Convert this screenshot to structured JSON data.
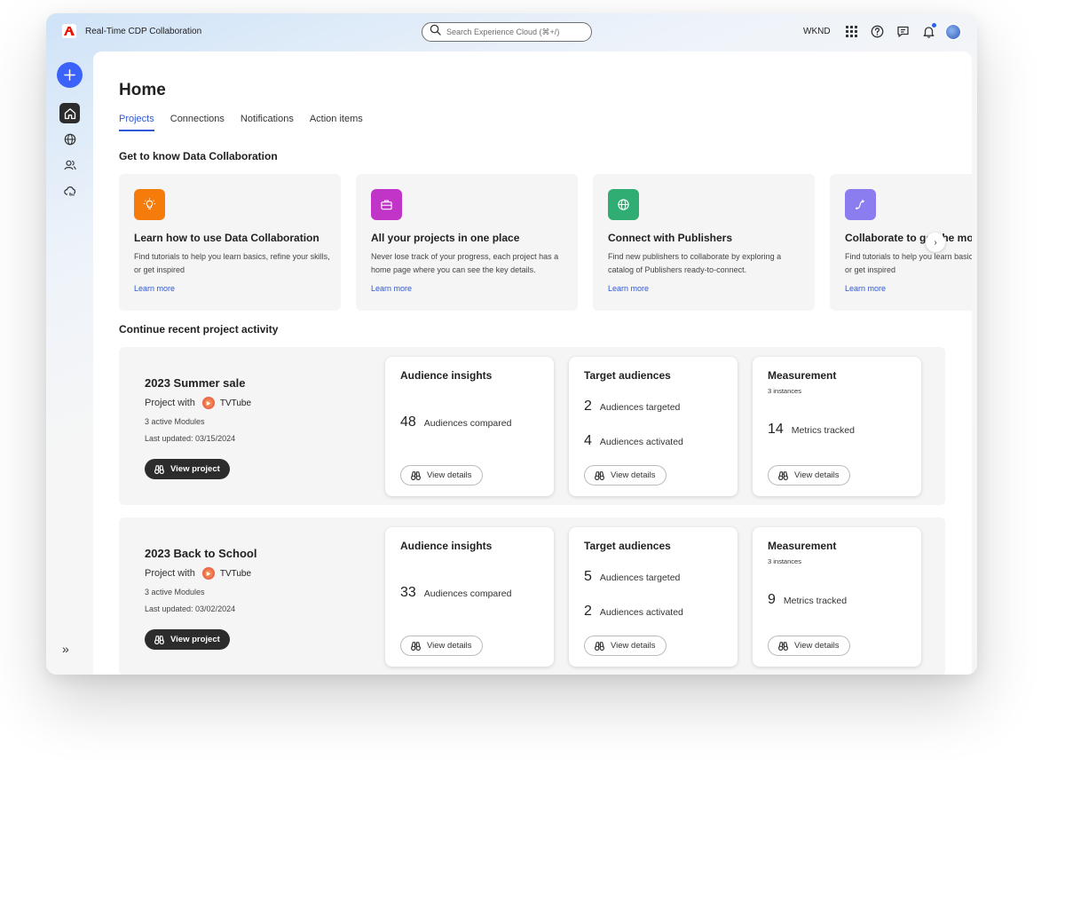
{
  "app": {
    "title": "Real-Time CDP Collaboration",
    "org": "WKND"
  },
  "search": {
    "placeholder": "Search Experience Cloud (⌘+/)"
  },
  "topbar_icons": [
    "apps-grid-icon",
    "help-icon",
    "feedback-icon",
    "bell-icon"
  ],
  "rail": {
    "items": [
      "home-icon",
      "globe-icon",
      "users-icon",
      "cloud-chart-icon"
    ],
    "expand_label": "»"
  },
  "page": {
    "title": "Home"
  },
  "tabs": [
    {
      "label": "Projects",
      "active": true
    },
    {
      "label": "Connections",
      "active": false
    },
    {
      "label": "Notifications",
      "active": false
    },
    {
      "label": "Action items",
      "active": false
    }
  ],
  "get_to_know": {
    "title": "Get to know Data Collaboration",
    "cards": [
      {
        "icon": "lightbulb-icon",
        "color": "#f57c0b",
        "title": "Learn how to use Data Collaboration",
        "description": "Find tutorials to help you learn basics, refine your skills, or get inspired",
        "link": "Learn more"
      },
      {
        "icon": "briefcase-icon",
        "color": "#c035c8",
        "title": "All your projects in one place",
        "description": "Never lose track of your progress, each project has a home page where you can see the key details.",
        "link": "Learn more"
      },
      {
        "icon": "globe-icon",
        "color": "#2fad72",
        "title": "Connect with Publishers",
        "description": "Find new publishers to collaborate by exploring a catalog of Publishers ready-to-connect.",
        "link": "Learn more"
      },
      {
        "icon": "path-icon",
        "color": "#8b7cf0",
        "title": "Collaborate to get the most",
        "description": "Find tutorials to help you learn basics, refine your skills, or get inspired",
        "link": "Learn more"
      }
    ],
    "next_label": "›"
  },
  "recent": {
    "title": "Continue recent project activity",
    "projects": [
      {
        "name": "2023 Summer sale",
        "with_label": "Project with",
        "partner": "TVTube",
        "modules_count": "3 active Modules",
        "last_updated": "Last updated: 03/15/2024",
        "view_label": "View project",
        "audience_insights": {
          "title": "Audience insights",
          "value": "48",
          "label": "Audiences compared",
          "button": "View details"
        },
        "target_audiences": {
          "title": "Target audiences",
          "targeted_value": "2",
          "targeted_label": "Audiences targeted",
          "activated_value": "4",
          "activated_label": "Audiences activated",
          "button": "View details"
        },
        "measurement": {
          "title": "Measurement",
          "instances": "3 instances",
          "value": "14",
          "label": "Metrics tracked",
          "button": "View details"
        }
      },
      {
        "name": "2023 Back to School",
        "with_label": "Project with",
        "partner": "TVTube",
        "modules_count": "3 active Modules",
        "last_updated": "Last updated: 03/02/2024",
        "view_label": "View project",
        "audience_insights": {
          "title": "Audience insights",
          "value": "33",
          "label": "Audiences compared",
          "button": "View details"
        },
        "target_audiences": {
          "title": "Target audiences",
          "targeted_value": "5",
          "targeted_label": "Audiences targeted",
          "activated_value": "2",
          "activated_label": "Audiences activated",
          "button": "View details"
        },
        "measurement": {
          "title": "Measurement",
          "instances": "3 instances",
          "value": "9",
          "label": "Metrics tracked",
          "button": "View details"
        }
      }
    ]
  }
}
